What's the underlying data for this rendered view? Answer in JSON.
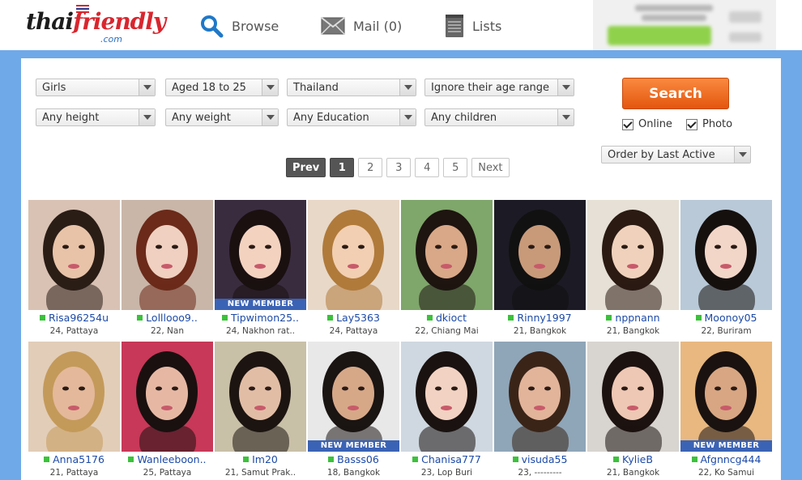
{
  "header": {
    "logo": {
      "part1": "thai",
      "part2": "friendly",
      "sub": ".com"
    },
    "nav": [
      {
        "label": "Browse",
        "icon": "search-icon"
      },
      {
        "label": "Mail (0)",
        "icon": "mail-icon"
      },
      {
        "label": "Lists",
        "icon": "notepad-icon"
      }
    ]
  },
  "filters": {
    "row1": [
      "Girls",
      "Aged 18 to 25",
      "Thailand",
      "Ignore their age range"
    ],
    "row2": [
      "Any height",
      "Any weight",
      "Any Education",
      "Any children"
    ],
    "order_by": "Order by Last Active"
  },
  "search": {
    "button_label": "Search",
    "online_label": "Online",
    "photo_label": "Photo",
    "online_checked": true,
    "photo_checked": true
  },
  "pagination": {
    "prev": "Prev",
    "pages": [
      "1",
      "2",
      "3",
      "4",
      "5"
    ],
    "current": "1",
    "next": "Next"
  },
  "badge_label": "NEW MEMBER",
  "profiles": [
    {
      "name": "Risa96254u",
      "meta": "24, Pattaya",
      "new": false,
      "bg": "#d9c2b4",
      "skin": "#e8c3a8",
      "hair": "#2a1d16"
    },
    {
      "name": "Lolllooo9..",
      "meta": "22, Nan",
      "new": false,
      "bg": "#c9b6a8",
      "skin": "#f0d0c0",
      "hair": "#6b2a1a"
    },
    {
      "name": "Tipwimon25..",
      "meta": "24, Nakhon rat..",
      "new": true,
      "bg": "#3a2c3f",
      "skin": "#f3d2c0",
      "hair": "#1a1010"
    },
    {
      "name": "Lay5363",
      "meta": "24, Pattaya",
      "new": false,
      "bg": "#e8d8c8",
      "skin": "#f2cfb2",
      "hair": "#b07a3a"
    },
    {
      "name": "dkioct",
      "meta": "22, Chiang Mai",
      "new": false,
      "bg": "#7fa66b",
      "skin": "#d8a888",
      "hair": "#1e1410"
    },
    {
      "name": "Rinny1997",
      "meta": "21, Bangkok",
      "new": false,
      "bg": "#1c1a24",
      "skin": "#c89a7a",
      "hair": "#111111"
    },
    {
      "name": "nppnann",
      "meta": "21, Bangkok",
      "new": false,
      "bg": "#e6e0d6",
      "skin": "#f0d2bc",
      "hair": "#2a1a12"
    },
    {
      "name": "Moonoy05",
      "meta": "22, Buriram",
      "new": false,
      "bg": "#b9c9d8",
      "skin": "#f2d6c8",
      "hair": "#15100e"
    },
    {
      "name": "Anna5176",
      "meta": "21, Pattaya",
      "new": false,
      "bg": "#e2cdb8",
      "skin": "#e4b89a",
      "hair": "#c49a5a"
    },
    {
      "name": "Wanleeboon..",
      "meta": "25, Pattaya",
      "new": false,
      "bg": "#c83858",
      "skin": "#e6b8a4",
      "hair": "#1a1010"
    },
    {
      "name": "Im20",
      "meta": "21, Samut Prak..",
      "new": false,
      "bg": "#c9c0a8",
      "skin": "#e2bda6",
      "hair": "#1c1410"
    },
    {
      "name": "Basss06",
      "meta": "18, Bangkok",
      "new": true,
      "bg": "#e8e8e8",
      "skin": "#d6a888",
      "hair": "#1a1412"
    },
    {
      "name": "Chanisa777",
      "meta": "23, Lop Buri",
      "new": false,
      "bg": "#cfd8e0",
      "skin": "#f2d2c2",
      "hair": "#1a1210"
    },
    {
      "name": "visuda55",
      "meta": "23, ---------",
      "new": false,
      "bg": "#8fa6b8",
      "skin": "#e2b49a",
      "hair": "#3a2418"
    },
    {
      "name": "KylieB",
      "meta": "21, Bangkok",
      "new": false,
      "bg": "#d8d4d0",
      "skin": "#eec8b4",
      "hair": "#1c1210"
    },
    {
      "name": "Afgnncg444",
      "meta": "22, Ko Samui",
      "new": true,
      "bg": "#e8b880",
      "skin": "#d8a682",
      "hair": "#1a1210"
    }
  ]
}
